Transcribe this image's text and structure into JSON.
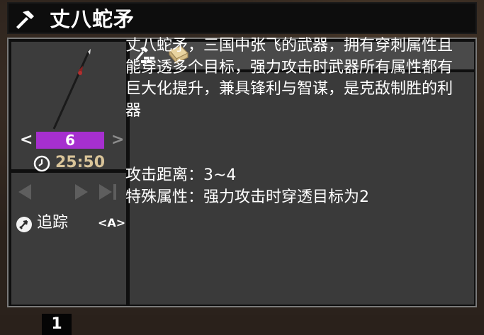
{
  "title": {
    "text": "丈八蛇矛",
    "icon": "hammer-icon"
  },
  "weapon": {
    "level": "6",
    "level_left": "<",
    "level_right": ">",
    "timer": "25:50",
    "clock_icon": "clock-icon",
    "art_icon": "spear-icon",
    "level_bar_color": "#a62fcf"
  },
  "tabs": [
    {
      "icon": "crafting-icon"
    },
    {
      "icon": "book-icon"
    }
  ],
  "description": {
    "text": "丈八蛇矛，三国中张飞的武器，拥有穿刺属性且能穿透多个目标，强力攻击时武器所有属性都有巨大化提升，兼具锋利与智谋，是克敌制胜的利器",
    "stats": [
      "攻击距离：3~4",
      "特殊属性：强力攻击时穿透目标为2"
    ]
  },
  "skill_panel": {
    "page": "1",
    "skill_name": "追踪",
    "skill_key": "<A>",
    "skill_icon": "tracking-icon"
  }
}
